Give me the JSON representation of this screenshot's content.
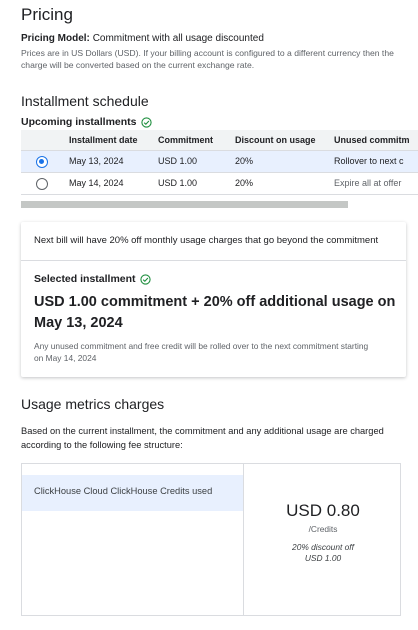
{
  "pricing": {
    "title": "Pricing",
    "model_label": "Pricing Model:",
    "model_value": "Commitment with all usage discounted",
    "currency_note": "Prices are in US Dollars (USD). If your billing account is configured to a different currency then the charge will be converted based on the current exchange rate."
  },
  "schedule": {
    "title": "Installment schedule",
    "upcoming_label": "Upcoming installments",
    "columns": [
      "Installment date",
      "Commitment",
      "Discount on usage",
      "Unused commitm"
    ],
    "rows": [
      {
        "date": "May 13, 2024",
        "commitment": "USD 1.00",
        "discount": "20%",
        "unused": "Rollover to next c",
        "selected": true
      },
      {
        "date": "May 14, 2024",
        "commitment": "USD 1.00",
        "discount": "20%",
        "unused": "Expire all at offer",
        "selected": false
      }
    ]
  },
  "card": {
    "next_bill": "Next bill will have 20% off monthly usage charges that go beyond the commitment",
    "selected_label": "Selected installment",
    "headline": "USD 1.00 commitment + 20% off additional usage on May 13, 2024",
    "rollover_note": "Any unused commitment and free credit will be rolled over to the next commitment starting on May 14, 2024"
  },
  "usage": {
    "title": "Usage metrics charges",
    "description": "Based on the current installment, the commitment and any additional usage are charged according to the following fee structure:",
    "item_label": "ClickHouse Cloud ClickHouse Credits used",
    "price": "USD 0.80",
    "unit": "/Credits",
    "discount_line1": "20% discount off",
    "discount_line2": "USD 1.00"
  },
  "colors": {
    "accent": "#1a73e8",
    "success": "#1e8e3e",
    "selected_row": "#e8f0fe"
  },
  "icons": [
    "check-circle-icon"
  ]
}
